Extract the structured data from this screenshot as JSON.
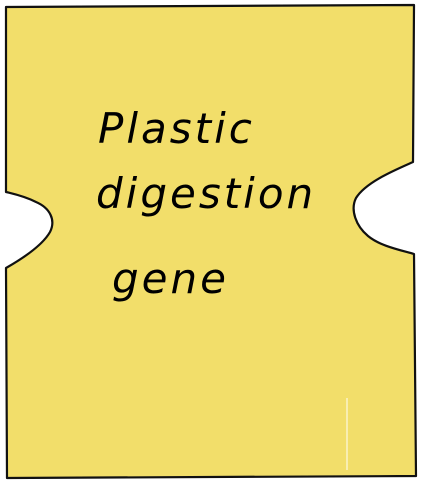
{
  "card": {
    "fill_color": "#F2DE6A",
    "stroke_color": "#111111",
    "lines": [
      "Plastic",
      "digestion",
      "gene"
    ]
  }
}
